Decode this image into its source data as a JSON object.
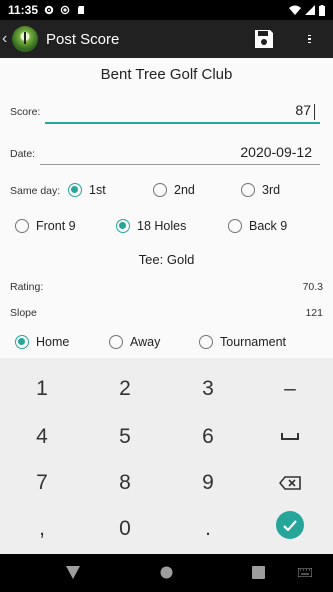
{
  "status_bar": {
    "time": "11:35"
  },
  "app_bar": {
    "title": "Post Score"
  },
  "form": {
    "club_name": "Bent Tree Golf Club",
    "score": {
      "label": "Score:",
      "value": "87"
    },
    "date": {
      "label": "Date:",
      "value": "2020-09-12"
    },
    "same_day": {
      "label": "Same day:",
      "options": [
        {
          "label": "1st",
          "checked": true
        },
        {
          "label": "2nd",
          "checked": false
        },
        {
          "label": "3rd",
          "checked": false
        }
      ]
    },
    "holes": {
      "options": [
        {
          "label": "Front 9",
          "checked": false
        },
        {
          "label": "18 Holes",
          "checked": true
        },
        {
          "label": "Back 9",
          "checked": false
        }
      ]
    },
    "tee": "Tee: Gold",
    "rating": {
      "label": "Rating:",
      "value": "70.3"
    },
    "slope": {
      "label": "Slope",
      "value": "121"
    },
    "location": {
      "options": [
        {
          "label": "Home",
          "checked": true
        },
        {
          "label": "Away",
          "checked": false
        },
        {
          "label": "Tournament",
          "checked": false
        }
      ]
    }
  },
  "keyboard": {
    "keys": [
      "1",
      "2",
      "3",
      "–",
      "4",
      "5",
      "6",
      "",
      "7",
      "8",
      "9",
      "",
      ",",
      "0",
      ".",
      ""
    ],
    "accent": "#26a69a"
  }
}
